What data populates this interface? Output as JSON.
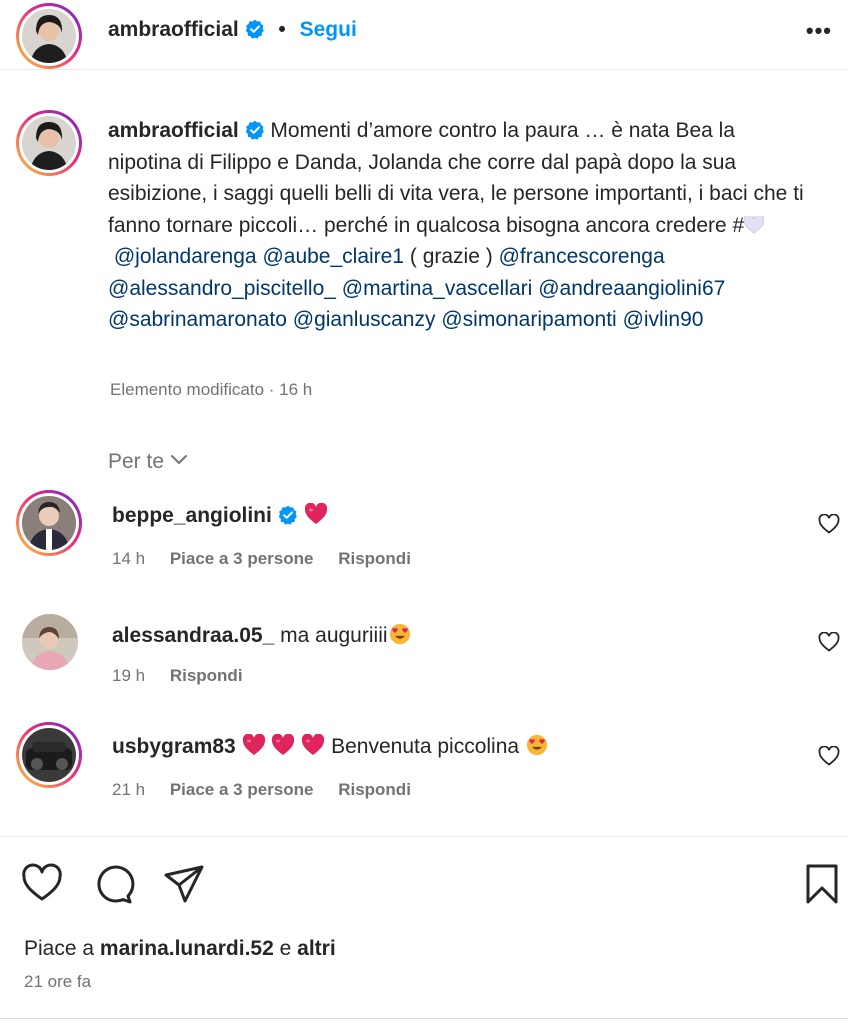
{
  "header": {
    "username": "ambraofficial",
    "separator": "•",
    "follow_label": "Segui",
    "more_label": "•••"
  },
  "caption": {
    "username": "ambraofficial",
    "text_1": "Momenti d’amore contro la paura … è nata Bea la nipotina di Filippo e Danda, Jolanda che corre dal papà dopo la sua esibizione, i saggi quelli belli di vita vera, le persone importanti, i baci che ti fanno tornare piccoli… perché in qualcosa bisogna ancora credere #",
    "mentions_1": [
      "@jolandarenga",
      "@aube_claire1"
    ],
    "text_2": "( grazie )",
    "mentions_2": [
      "@francescorenga",
      "@alessandro_piscitello_",
      "@martina_vascellari",
      "@andreaangiolini67",
      "@sabrinamaronato",
      "@gianluscanzy",
      "@simonaripamonti",
      "@ivlin90"
    ],
    "meta": "Elemento modificato · 16 h"
  },
  "per_te": "Per te",
  "comments": [
    {
      "username": "beppe_angiolini",
      "text": "",
      "time": "14 h",
      "likes": "Piace a 3 persone",
      "reply": "Rispondi"
    },
    {
      "username": "alessandraa.05_",
      "text": "ma auguriiii",
      "time": "19 h",
      "likes": "",
      "reply": "Rispondi"
    },
    {
      "username": "usbygram83",
      "text": "Benvenuta piccolina",
      "time": "21 h",
      "likes": "Piace a 3 persone",
      "reply": "Rispondi"
    }
  ],
  "footer": {
    "likes_prefix": "Piace a ",
    "likes_user": "marina.lunardi.52",
    "likes_mid": " e ",
    "likes_others": "altri",
    "time_ago": "21 ore fa"
  },
  "colors": {
    "link": "#0095f6",
    "mention": "#00376b",
    "secondary_text": "#737373",
    "heart_red": "#e0245e"
  },
  "icons": [
    "verified-badge-icon",
    "more-icon",
    "chevron-down-icon",
    "like-icon",
    "comment-icon",
    "share-icon",
    "save-icon",
    "heart-emoji-icon",
    "heart-eyes-emoji-icon",
    "white-heart-emoji-icon"
  ]
}
